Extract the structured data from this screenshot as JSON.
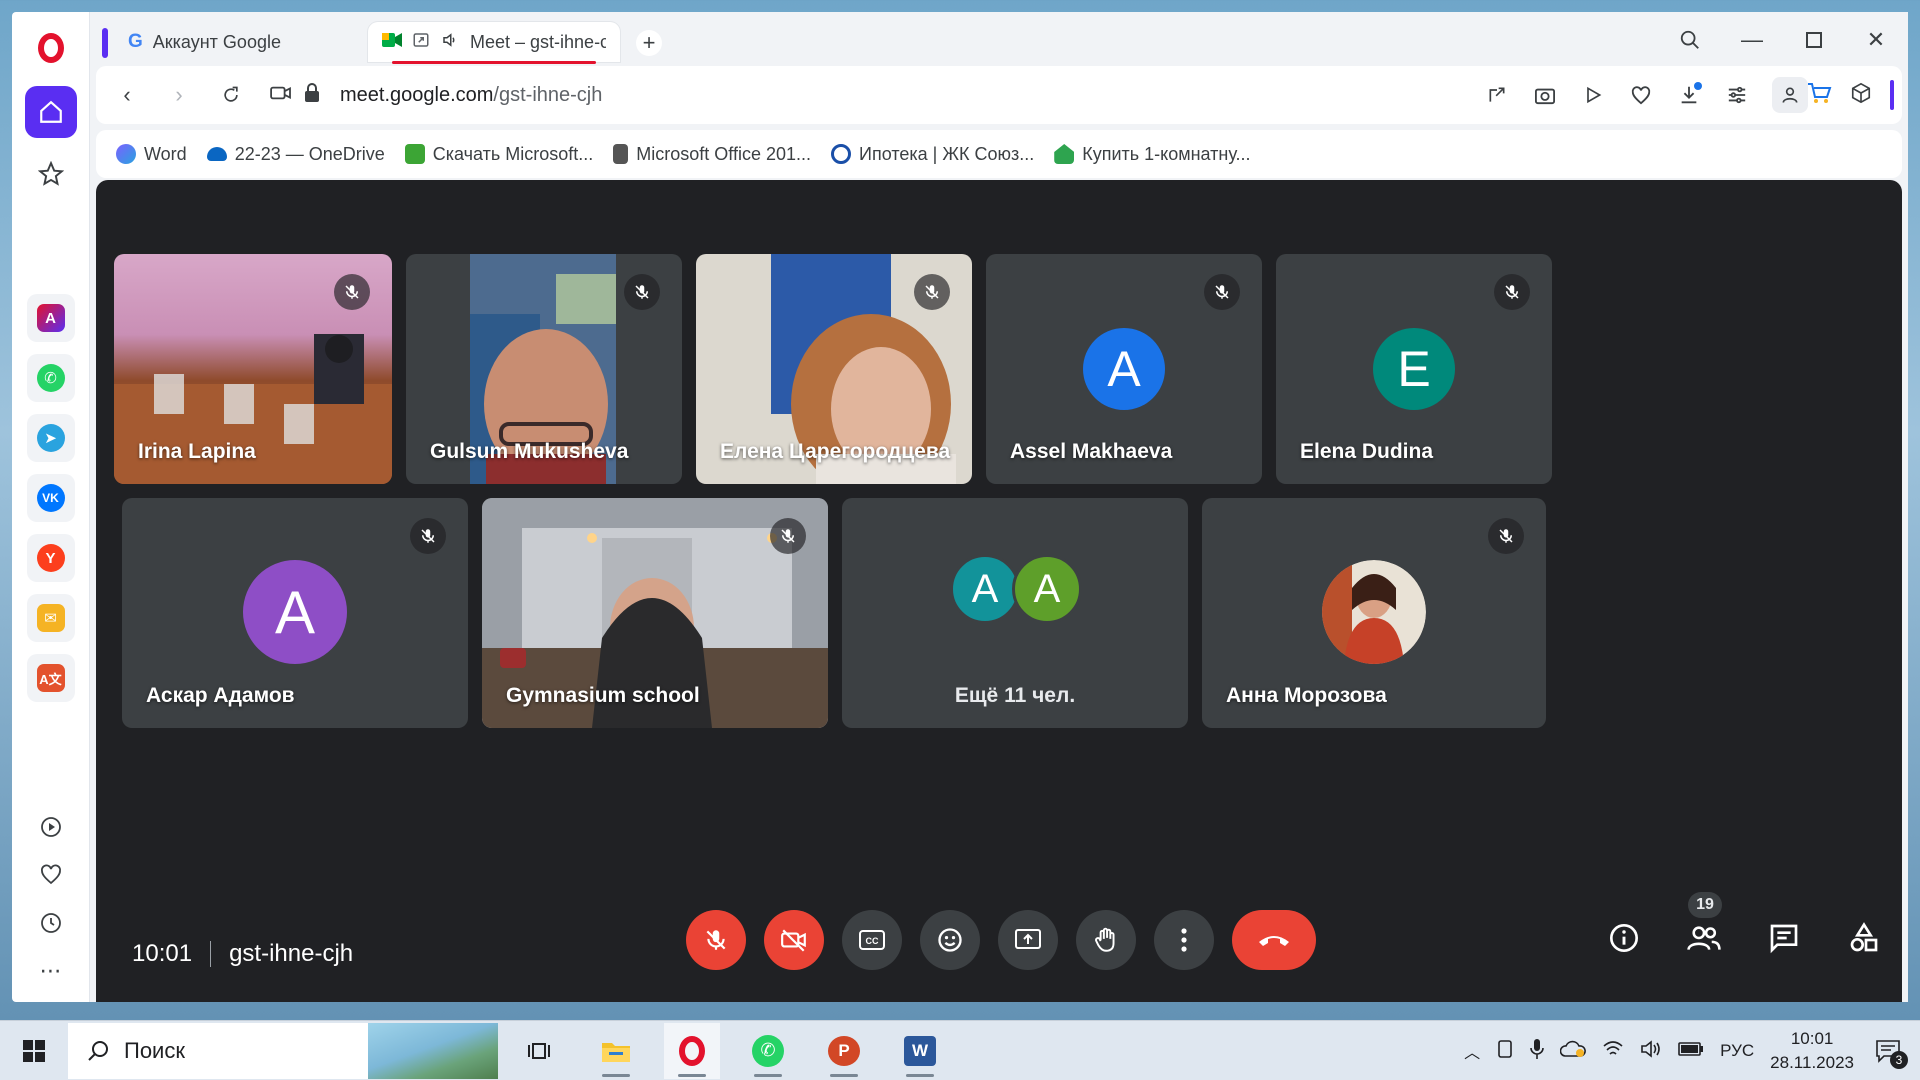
{
  "browser": {
    "tabs": [
      {
        "title": "Аккаунт Google",
        "active": false
      },
      {
        "title": "Meet – gst-ihne-cjh",
        "active": true
      }
    ],
    "url_host": "meet.google.com",
    "url_path": "/gst-ihne-cjh",
    "bookmarks": [
      {
        "label": "Word",
        "color": "#7b61ff"
      },
      {
        "label": "22-23 — OneDrive",
        "color": "#0a66c2"
      },
      {
        "label": "Скачать Microsoft...",
        "color": "#3ca535"
      },
      {
        "label": "Microsoft Office 201...",
        "color": "#555555"
      },
      {
        "label": "Ипотека | ЖК Союз...",
        "color": "#e3122d"
      },
      {
        "label": "Купить 1-комнатну...",
        "color": "#2ea44f"
      }
    ]
  },
  "meet": {
    "tiles": [
      {
        "name": "Irina Lapina",
        "kind": "video",
        "muted": true
      },
      {
        "name": "Gulsum Mukusheva",
        "kind": "video",
        "muted": true
      },
      {
        "name": "Елена Царегородцева",
        "kind": "video",
        "muted": true
      },
      {
        "name": "Assel Makhaeva",
        "kind": "avatar",
        "letter": "A",
        "color": "#1a73e8",
        "muted": true
      },
      {
        "name": "Elena Dudina",
        "kind": "avatar",
        "letter": "E",
        "color": "#00897b",
        "muted": true
      },
      {
        "name": "Аскар Адамов",
        "kind": "avatar",
        "letter": "A",
        "color": "#8e4ec6",
        "muted": true
      },
      {
        "name": "Gymnasium school",
        "kind": "video",
        "muted": true
      },
      {
        "name": "",
        "kind": "more",
        "letters": [
          "A",
          "A"
        ],
        "colors": [
          "#12939a",
          "#5e9f2a"
        ],
        "label": "Ещё 11 чел."
      },
      {
        "name": "Анна Морозова",
        "kind": "photo",
        "muted": true
      }
    ],
    "time": "10:01",
    "meeting_code": "gst-ihne-cjh",
    "participants_count": "19"
  },
  "taskbar": {
    "search_placeholder": "Поиск",
    "language": "РУС",
    "time": "10:01",
    "date": "28.11.2023",
    "notifications": "3"
  },
  "colors": {
    "meet_bg": "#202124",
    "tile_bg": "#3c4043",
    "danger": "#ea4335",
    "opera_red": "#e3122d",
    "opera_accent": "#5a2ef2"
  }
}
